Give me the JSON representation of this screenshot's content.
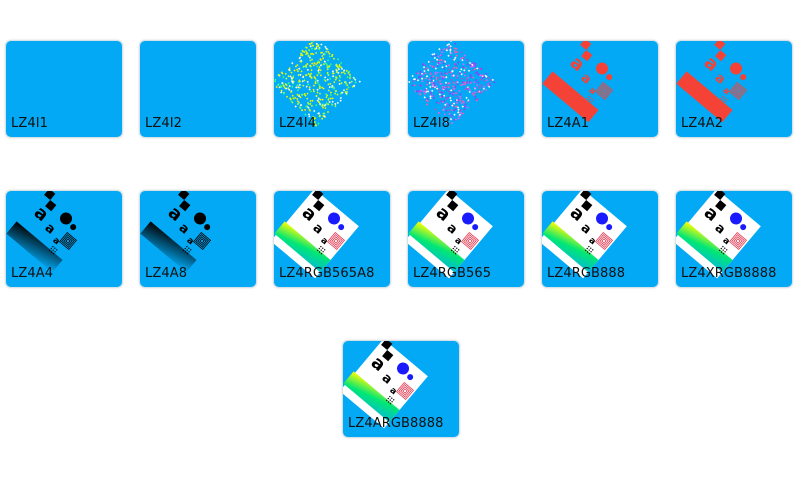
{
  "colors": {
    "tile_background": "#03a9f4",
    "tile_border": "#d6e2ea",
    "label_text": "#111111"
  },
  "tiles": [
    {
      "label": "LZ4I1",
      "thumbnail": "blank"
    },
    {
      "label": "LZ4I2",
      "thumbnail": "blank"
    },
    {
      "label": "LZ4I4",
      "thumbnail": "noise-yellow-green"
    },
    {
      "label": "LZ4I8",
      "thumbnail": "noise-purple-pink"
    },
    {
      "label": "LZ4A1",
      "thumbnail": "test-pattern-red"
    },
    {
      "label": "LZ4A2",
      "thumbnail": "test-pattern-red"
    },
    {
      "label": "LZ4A4",
      "thumbnail": "test-pattern-black"
    },
    {
      "label": "LZ4A8",
      "thumbnail": "test-pattern-black"
    },
    {
      "label": "LZ4RGB565A8",
      "thumbnail": "test-pattern-color"
    },
    {
      "label": "LZ4RGB565",
      "thumbnail": "test-pattern-color"
    },
    {
      "label": "LZ4RGB888",
      "thumbnail": "test-pattern-color"
    },
    {
      "label": "LZ4XRGB8888",
      "thumbnail": "test-pattern-color"
    },
    {
      "label": "LZ4ARGB8888",
      "thumbnail": "test-pattern-color"
    }
  ]
}
